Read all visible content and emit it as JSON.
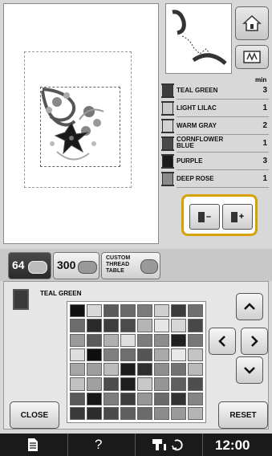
{
  "thread_list": {
    "min_header": "min",
    "rows": [
      {
        "name": "TEAL GREEN",
        "minutes": "3",
        "color": "#3a3f3c"
      },
      {
        "name": "LIGHT LILAC",
        "minutes": "1",
        "color": "#c9c9c9"
      },
      {
        "name": "WARM GRAY",
        "minutes": "2",
        "color": "#d2d2d2"
      },
      {
        "name": "CORNFLOWER BLUE",
        "name_line1": "CORNFLOWER",
        "name_line2": "BLUE",
        "minutes": "1",
        "color": "#4a4a4a"
      },
      {
        "name": "PURPLE",
        "minutes": "3",
        "color": "#1a1a1a"
      },
      {
        "name": "DEEP ROSE",
        "minutes": "1",
        "color": "#8a8a8a"
      }
    ]
  },
  "spool_controls": {
    "minus_label": "–",
    "plus_label": "+"
  },
  "tabs": {
    "tab64": {
      "label": "64"
    },
    "tab300": {
      "label": "300"
    },
    "custom": {
      "line1": "CUSTOM",
      "line2": "THREAD",
      "line3": "TABLE"
    }
  },
  "color_panel": {
    "current_thread_name": "TEAL GREEN",
    "current_color": "#3a3a3a",
    "grid_colors": [
      "#111111",
      "#d8d8d8",
      "#5a5a5a",
      "#6a6a6a",
      "#7a7a7a",
      "#cfcfcf",
      "#3c3c3c",
      "#6f6f6f",
      "#6c6c6c",
      "#2a2a2a",
      "#3d3d3d",
      "#4b4b4b",
      "#b5b5b5",
      "#e6e6e6",
      "#d6d6d6",
      "#484848",
      "#9a9a9a",
      "#5c5c5c",
      "#b0b0b0",
      "#e0e0e0",
      "#7c7c7c",
      "#8c8c8c",
      "#222222",
      "#777777",
      "#dddddd",
      "#0f0f0f",
      "#808080",
      "#6e6e6e",
      "#555555",
      "#aaaaaa",
      "#e8e8e8",
      "#c4c4c4",
      "#a6a6a6",
      "#9e9e9e",
      "#bcbcbc",
      "#1c1c1c",
      "#2f2f2f",
      "#8e8e8e",
      "#727272",
      "#b9b9b9",
      "#c0c0c0",
      "#a0a0a0",
      "#4c4c4c",
      "#1e1e1e",
      "#c8c8c8",
      "#959595",
      "#5e5e5e",
      "#4e4e4e",
      "#5a5a5a",
      "#171717",
      "#7e7e7e",
      "#3e3e3e",
      "#979797",
      "#6a6a6a",
      "#333333",
      "#858585",
      "#3a3a3a",
      "#2c2c2c",
      "#4a4a4a",
      "#5f5f5f",
      "#6b6b6b",
      "#8c8c8c",
      "#9a9a9a",
      "#b4b4b4"
    ],
    "close_label": "CLOSE",
    "reset_label": "RESET"
  },
  "status_bar": {
    "question_label": "?",
    "time": "12:00"
  }
}
